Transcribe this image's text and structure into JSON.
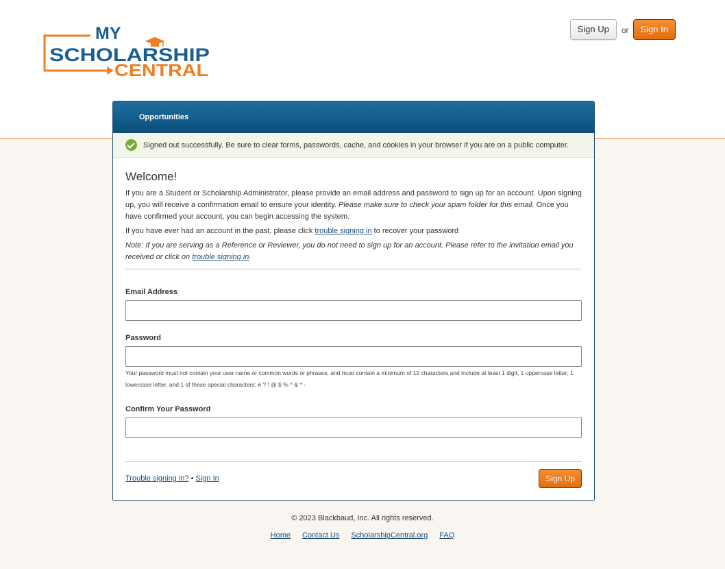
{
  "logo": {
    "line1": "MY",
    "line2": "SCHOLARSHIP",
    "line3": "CENTRAL",
    "colors": {
      "blue": "#1b5e92",
      "orange": "#f07d1f"
    }
  },
  "header": {
    "signup_label": "Sign Up",
    "or_text": "or",
    "signin_label": "Sign In"
  },
  "nav": {
    "tab_label": "Opportunities"
  },
  "alert": {
    "icon": "check-circle-icon",
    "message": "Signed out successfully. Be sure to clear forms, passwords, cache, and cookies in your browser if you are on a public computer."
  },
  "welcome": {
    "title": "Welcome!",
    "p1_text": "If you are a Student or Scholarship Administrator, please provide an email address and password to sign up for an account. Upon signing up, you will receive a confirmation email to ensure your identity. ",
    "p1_italic": "Please make sure to check your spam folder for this email.",
    "p1_tail": " Once you have confirmed your account, you can begin accessing the system.",
    "p2_before": "If you have ever had an account in the past, please click ",
    "p2_link": "trouble signing in",
    "p2_after": " to recover your password",
    "p3_before": "Note: If you are serving as a Reference or Reviewer, you do not need to sign up for an account. Please refer to the invitation email you received or click on ",
    "p3_link": "trouble signing in",
    "p3_after": "."
  },
  "form": {
    "email_label": "Email Address",
    "email_value": "",
    "password_label": "Password",
    "password_value": "",
    "password_hint": "Your password must not contain your user name or common words or phrases, and must contain a minimum of 12 characters and include at least 1 digit, 1 uppercase letter, 1 lowercase letter, and 1 of these special characters: # ? ! @ $ % ^ & * -",
    "confirm_label": "Confirm Your Password",
    "confirm_value": ""
  },
  "form_footer": {
    "trouble_link": "Trouble signing in?",
    "separator": "•",
    "signin_link": "Sign In",
    "signup_button": "Sign Up"
  },
  "page_footer": {
    "copyright": "© 2023 Blackbaud, Inc. All rights reserved.",
    "links": [
      "Home",
      "Contact Us",
      "ScholarshipCentral.org",
      "FAQ"
    ]
  }
}
